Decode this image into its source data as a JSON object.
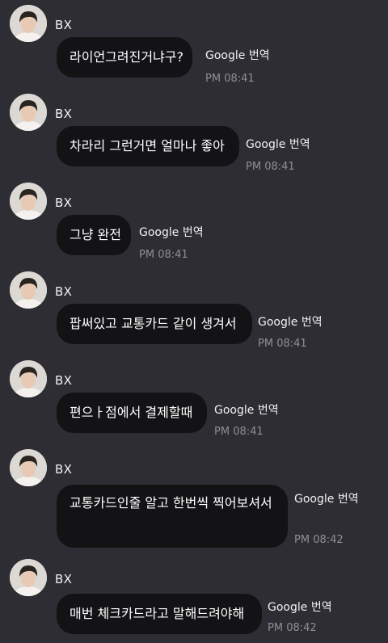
{
  "messages": [
    {
      "sender": "BX",
      "text": "라이언그려진거냐구?",
      "translate": "Google 번역",
      "time": "PM 08:41"
    },
    {
      "sender": "BX",
      "text": "차라리 그런거면 얼마나 좋아",
      "translate": "Google 번역",
      "time": "PM 08:41"
    },
    {
      "sender": "BX",
      "text": "그냥 완전",
      "translate": "Google 번역",
      "time": "PM 08:41"
    },
    {
      "sender": "BX",
      "text": "팝써있고 교통카드 같이 생겨서",
      "translate": "Google 번역",
      "time": "PM 08:41"
    },
    {
      "sender": "BX",
      "text": "편으ㅏ점에서 결제할때",
      "translate": "Google 번역",
      "time": "PM 08:41"
    },
    {
      "sender": "BX",
      "text": "교통카드인줄 알고 한번씩 찍어보셔서",
      "translate": "Google 번역",
      "time": "PM 08:42"
    },
    {
      "sender": "BX",
      "text": "매번 체크카드라고 말해드려야해",
      "translate": "Google 번역",
      "time": "PM 08:42"
    }
  ]
}
